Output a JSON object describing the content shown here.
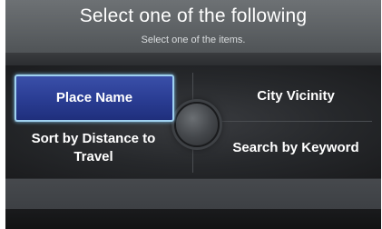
{
  "header": {
    "title": "Select one of the following",
    "subtitle": "Select one of the items."
  },
  "menu": {
    "items": [
      {
        "label": "Place Name",
        "selected": true
      },
      {
        "label": "City Vicinity",
        "selected": false
      },
      {
        "label": "Sort by Distance to Travel",
        "selected": false
      },
      {
        "label": "Search by Keyword",
        "selected": false
      }
    ]
  },
  "colors": {
    "selected_fill": "#2b3e95",
    "selected_border": "#9fd1f0"
  }
}
